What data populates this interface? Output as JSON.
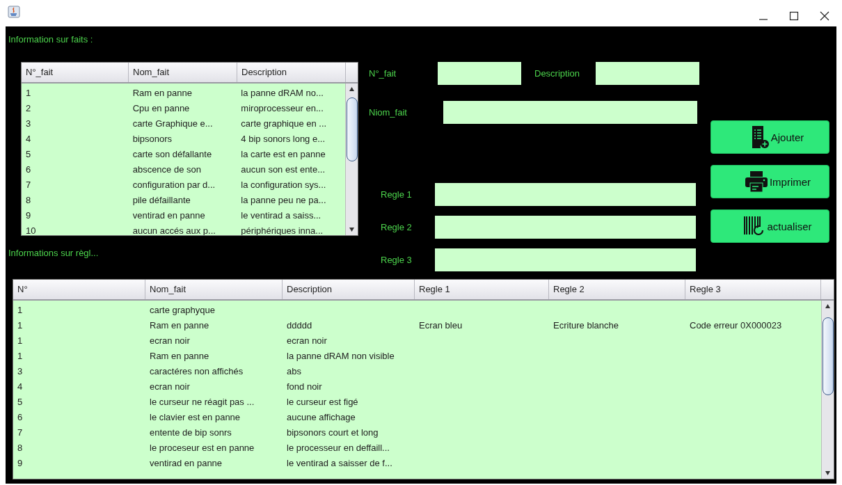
{
  "facts_title": "Information sur faits :",
  "facts_table": {
    "columns": [
      "N°_fait",
      "Nom_fait",
      "Description"
    ],
    "rows": [
      [
        "1",
        "Ram en panne",
        "la panne dRAM no..."
      ],
      [
        "2",
        "Cpu en panne",
        "miroprocesseur en..."
      ],
      [
        "3",
        " carte Graphique e...",
        "carte graphique en ..."
      ],
      [
        "4",
        "bipsonors",
        "4 bip sonors long e..."
      ],
      [
        "5",
        "carte son défallante",
        "la carte est en panne"
      ],
      [
        "6",
        "abscence de son",
        "aucun son est ente..."
      ],
      [
        "7",
        "configuration par d...",
        "la configuration sys..."
      ],
      [
        "8",
        "pile défaillante",
        "la panne peu ne pa..."
      ],
      [
        "9",
        "ventirad en panne",
        "le ventirad a saiss..."
      ],
      [
        "10",
        "aucun accés aux p...",
        "périphériques inna..."
      ]
    ]
  },
  "rules_title": "Informations sur règl...",
  "form": {
    "fact_fields": [
      {
        "label": "N°_fait"
      },
      {
        "label": "Description"
      },
      {
        "label": "Niom_fait"
      }
    ],
    "rule_fields": [
      {
        "label": "Regle 1"
      },
      {
        "label": "Regle 2"
      },
      {
        "label": "Regle 3"
      }
    ]
  },
  "buttons": [
    {
      "label": "Ajouter",
      "kind": "add"
    },
    {
      "label": "Imprimer",
      "kind": "print"
    },
    {
      "label": "actualiser",
      "kind": "refresh"
    }
  ],
  "rules_table": {
    "columns": [
      "N°",
      "Nom_fait",
      "Description",
      "Regle 1",
      "Regle 2",
      "Regle 3"
    ],
    "rows": [
      [
        "1",
        "carte graphyque",
        "",
        "",
        "",
        ""
      ],
      [
        "1",
        "Ram en panne",
        "ddddd",
        "Ecran bleu",
        "Ecriture blanche",
        "Code erreur 0X000023"
      ],
      [
        "1",
        "ecran noir",
        "ecran noir",
        "",
        "",
        ""
      ],
      [
        "1",
        "Ram en panne",
        "la panne dRAM non visible",
        "",
        "",
        ""
      ],
      [
        "3",
        "caractéres non affichés",
        "abs",
        "",
        "",
        ""
      ],
      [
        "4",
        "ecran noir",
        "fond noir",
        "",
        "",
        ""
      ],
      [
        "5",
        "le curseur ne réagit pas ...",
        "le curseur est figé",
        "",
        "",
        ""
      ],
      [
        "6",
        "le clavier est en panne",
        "aucune affichage",
        "",
        "",
        ""
      ],
      [
        "7",
        "entente de bip sonrs",
        "bipsonors court et long",
        "",
        "",
        ""
      ],
      [
        "8",
        "le proceseur est en panne",
        "le processeur  en deffaill...",
        "",
        "",
        ""
      ],
      [
        "9",
        "ventirad en panne",
        "le ventirad a saisser de f...",
        "",
        "",
        ""
      ]
    ]
  }
}
